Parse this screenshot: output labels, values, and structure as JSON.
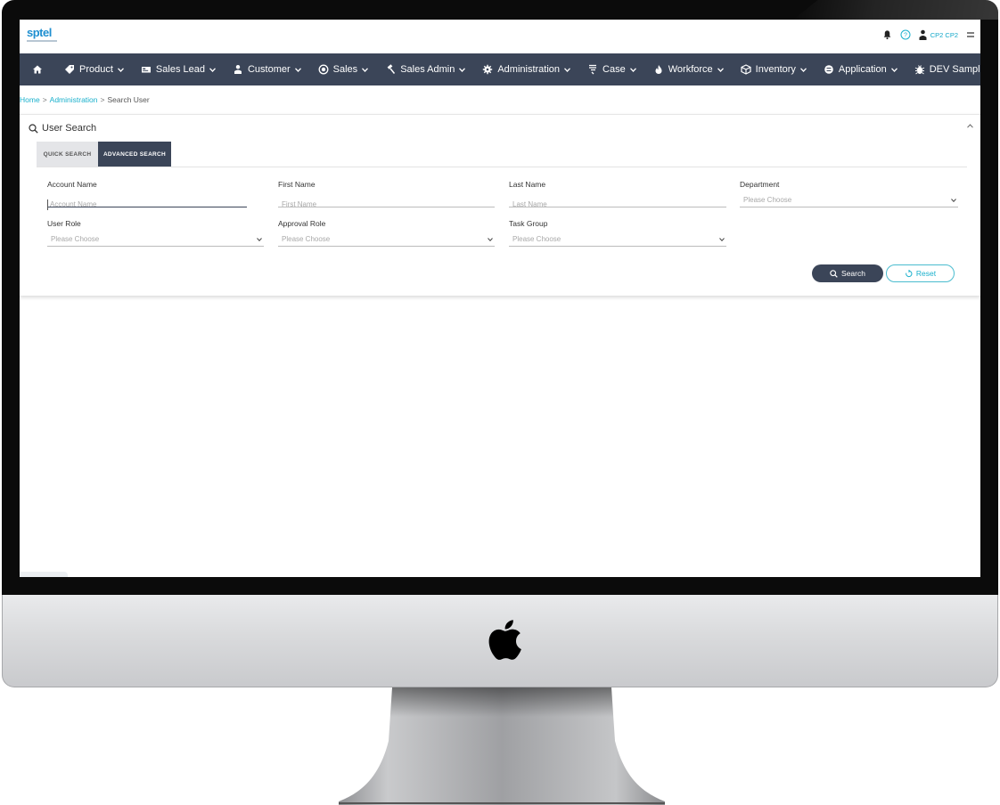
{
  "topbar": {
    "logo_text": "sptel",
    "user_name": "CP2 CP2",
    "icons": [
      "bell-icon",
      "help-icon",
      "user-icon",
      "menu-icon"
    ]
  },
  "nav": {
    "items": [
      {
        "label": "",
        "icon": "home-icon"
      },
      {
        "label": "Product",
        "icon": "tag-icon"
      },
      {
        "label": "Sales Lead",
        "icon": "card-icon"
      },
      {
        "label": "Customer",
        "icon": "person-icon"
      },
      {
        "label": "Sales",
        "icon": "coin-icon"
      },
      {
        "label": "Sales Admin",
        "icon": "gavel-icon"
      },
      {
        "label": "Administration",
        "icon": "cog-icon"
      },
      {
        "label": "Case",
        "icon": "flag-icon"
      },
      {
        "label": "Workforce",
        "icon": "fire-icon"
      },
      {
        "label": "Inventory",
        "icon": "cube-icon"
      },
      {
        "label": "Application",
        "icon": "box-icon"
      },
      {
        "label": "DEV Sample",
        "icon": "bug-icon"
      }
    ]
  },
  "breadcrumb": {
    "home": "Home",
    "administration": "Administration",
    "current": "Search User"
  },
  "panel": {
    "title": "User Search",
    "tabs": {
      "quick": "QUICK SEARCH",
      "advanced": "ADVANCED SEARCH"
    },
    "fields": {
      "account_name": {
        "label": "Account Name",
        "placeholder": "Account Name"
      },
      "first_name": {
        "label": "First Name",
        "placeholder": "First Name"
      },
      "last_name": {
        "label": "Last Name",
        "placeholder": "Last Name"
      },
      "department": {
        "label": "Department",
        "value": "Please Choose"
      },
      "user_role": {
        "label": "User Role",
        "value": "Please Choose"
      },
      "approval_role": {
        "label": "Approval Role",
        "value": "Please Choose"
      },
      "task_group": {
        "label": "Task Group",
        "value": "Please Choose"
      }
    },
    "buttons": {
      "search": "Search",
      "reset": "Reset"
    }
  },
  "colors": {
    "navbar": "#3b4558",
    "accent": "#1ab0cc",
    "logo": "#1f8fd0"
  }
}
